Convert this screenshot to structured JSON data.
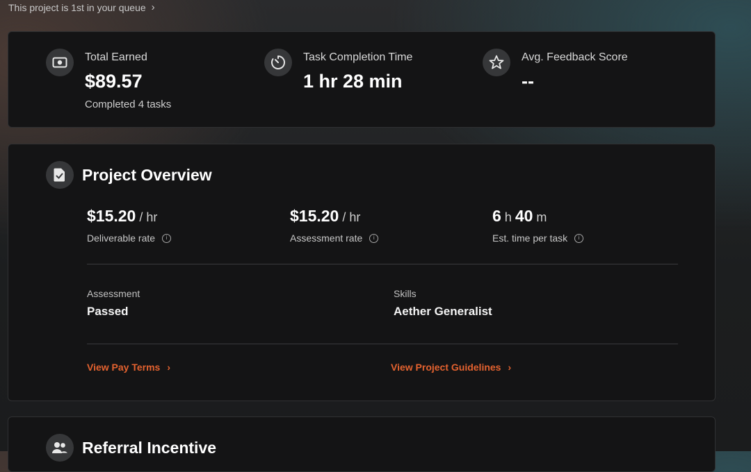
{
  "queue_banner": {
    "text": "This project is 1st in your queue",
    "chevron": "chevron-right-icon"
  },
  "stats": [
    {
      "icon": "money-icon",
      "label": "Total Earned",
      "value": "$89.57",
      "sub": "Completed 4 tasks"
    },
    {
      "icon": "timer-icon",
      "label": "Task Completion Time",
      "value": "1 hr 28 min",
      "sub": ""
    },
    {
      "icon": "star-icon",
      "label": "Avg. Feedback Score",
      "value": "--",
      "sub": ""
    }
  ],
  "overview": {
    "icon": "document-check-icon",
    "title": "Project Overview",
    "rates": [
      {
        "amount": "$15.20",
        "unit": " / hr",
        "label": "Deliverable rate"
      },
      {
        "amount": "$15.20",
        "unit": " / hr",
        "label": "Assessment rate"
      }
    ],
    "est_time": {
      "hours": "6",
      "h_unit": " h ",
      "minutes": "40",
      "m_unit": " m",
      "label": "Est. time per task"
    },
    "fields": [
      {
        "key": "Assessment",
        "value": "Passed"
      },
      {
        "key": "Skills",
        "value": "Aether Generalist"
      }
    ],
    "links": [
      {
        "label": "View Pay Terms"
      },
      {
        "label": "View Project Guidelines"
      }
    ]
  },
  "referral": {
    "icon": "people-icon",
    "title": "Referral Incentive"
  },
  "colors": {
    "accent": "#e4622f",
    "card_bg": "#141415",
    "icon_bg": "#363739"
  }
}
